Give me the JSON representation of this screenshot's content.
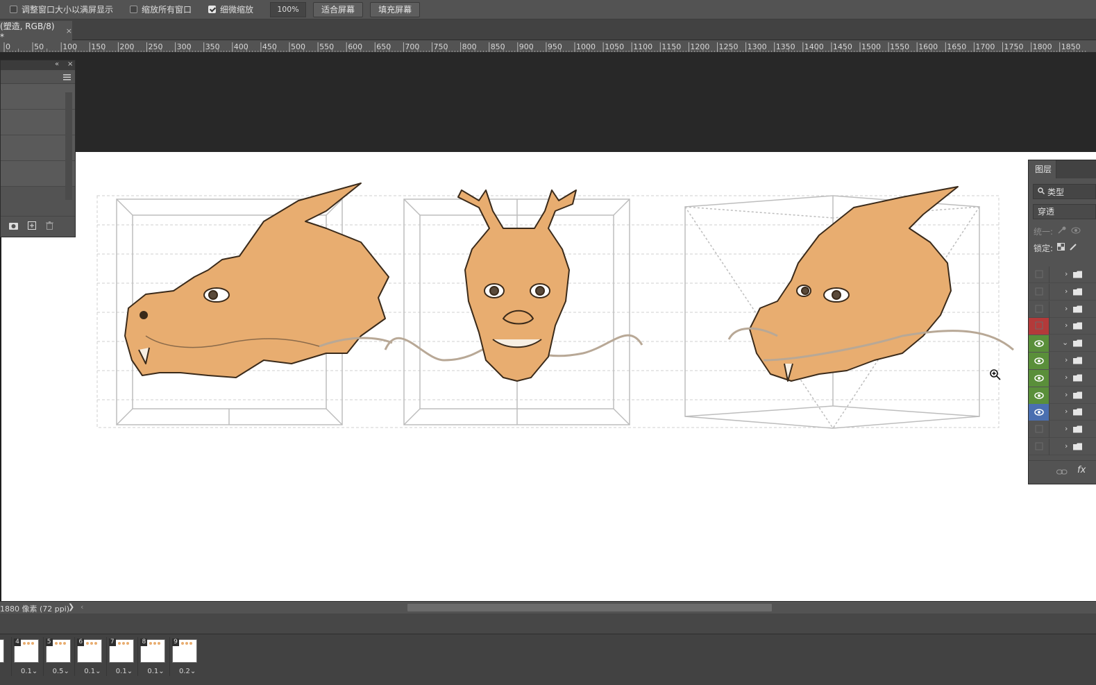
{
  "options_bar": {
    "resize_windows_label": "调整窗口大小以满屏显示",
    "resize_windows_checked": false,
    "zoom_all_label": "缩放所有窗口",
    "zoom_all_checked": false,
    "scrubby_zoom_label": "细微缩放",
    "scrubby_zoom_checked": true,
    "zoom_value": "100%",
    "fit_screen_label": "适合屏幕",
    "fill_screen_label": "填充屏幕"
  },
  "document_tab": {
    "title": "(塑造, RGB/8) *",
    "close": "×"
  },
  "ruler": {
    "labels": [
      "0",
      "50",
      "100",
      "150",
      "200",
      "250",
      "300",
      "350",
      "400",
      "450",
      "500",
      "550",
      "600",
      "650",
      "700",
      "750",
      "800",
      "850",
      "900",
      "950",
      "1000",
      "1050",
      "1100",
      "1150",
      "1200",
      "1250",
      "1300",
      "1350",
      "1400",
      "1450",
      "1500",
      "1550",
      "1600",
      "1650",
      "1700",
      "1750",
      "1800",
      "1850"
    ]
  },
  "status_bar": {
    "doc_info": "1880 像素 (72 ppi)",
    "arrow": "❯",
    "scroll_left": "‹"
  },
  "layers_panel": {
    "tab_label": "图层",
    "filter_kind": "类型",
    "blend_mode": "穿透",
    "unify_label": "统一:",
    "lock_label": "锁定:",
    "rows": [
      {
        "eye": "off",
        "color": "none",
        "expanded": false
      },
      {
        "eye": "off",
        "color": "none",
        "expanded": false
      },
      {
        "eye": "off",
        "color": "none",
        "expanded": false
      },
      {
        "eye": "off",
        "color": "red",
        "expanded": false
      },
      {
        "eye": "on",
        "color": "green",
        "expanded": true
      },
      {
        "eye": "on",
        "color": "green",
        "expanded": false
      },
      {
        "eye": "on",
        "color": "green",
        "expanded": false
      },
      {
        "eye": "on",
        "color": "green",
        "expanded": false
      },
      {
        "eye": "on",
        "color": "blue",
        "expanded": false
      },
      {
        "eye": "off",
        "color": "none",
        "expanded": false
      },
      {
        "eye": "off",
        "color": "none",
        "expanded": false
      }
    ],
    "fx_label": "fx"
  },
  "timeline": {
    "frames": [
      {
        "num": "4",
        "delay": "0.1"
      },
      {
        "num": "5",
        "delay": "0.5"
      },
      {
        "num": "6",
        "delay": "0.1"
      },
      {
        "num": "7",
        "delay": "0.1"
      },
      {
        "num": "8",
        "delay": "0.1"
      },
      {
        "num": "9",
        "delay": "0.2"
      }
    ]
  },
  "colors": {
    "dragon_fill": "#e8ad70",
    "dragon_line": "#3a2a1a",
    "guide_line": "#c8c8c8",
    "label_red": "#b33a3a",
    "label_green": "#5a8f3a",
    "label_blue": "#4a6fb0"
  },
  "icons": {
    "zoom_cursor": "zoom-in-icon"
  }
}
